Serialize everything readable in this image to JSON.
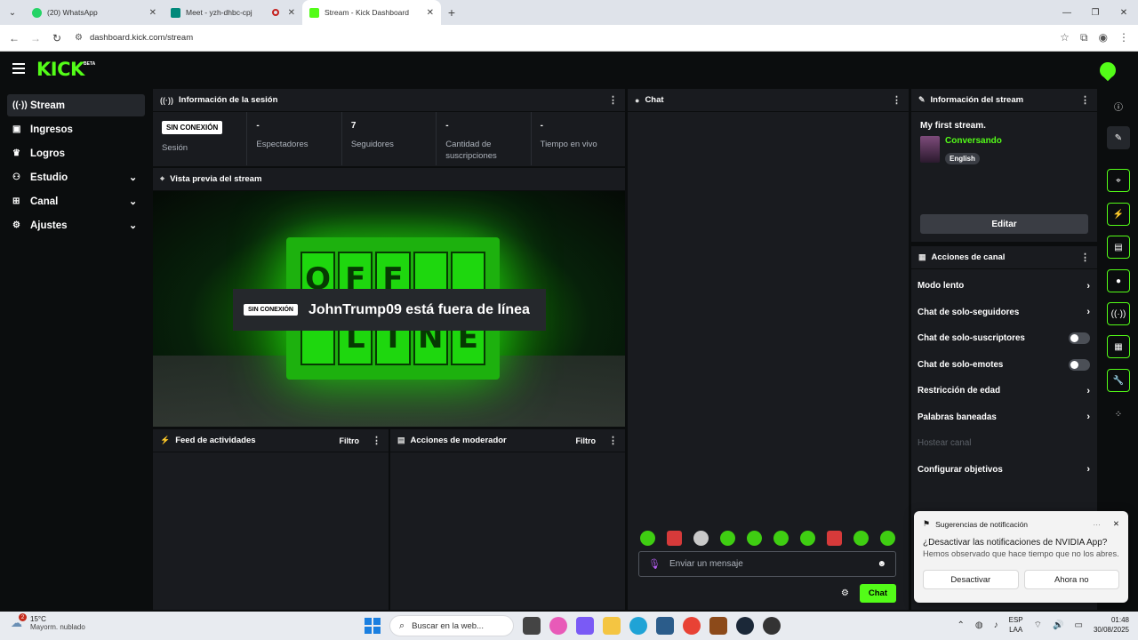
{
  "browser": {
    "tabs": [
      {
        "title": "(20) WhatsApp",
        "favicon_color": "#25d366"
      },
      {
        "title": "Meet - yzh-dhbc-cpj",
        "favicon_color": "#00897b"
      },
      {
        "title": "Stream - Kick Dashboard",
        "favicon_color": "#53fc18"
      }
    ],
    "url": "dashboard.kick.com/stream"
  },
  "header": {
    "logo": "KICK",
    "logo_badge": "BETA"
  },
  "sidebar": {
    "items": [
      {
        "label": "Stream",
        "icon": "broadcast-icon"
      },
      {
        "label": "Ingresos",
        "icon": "wallet-icon"
      },
      {
        "label": "Logros",
        "icon": "trophy-icon"
      },
      {
        "label": "Estudio",
        "icon": "studio-icon"
      },
      {
        "label": "Canal",
        "icon": "channel-icon"
      },
      {
        "label": "Ajustes",
        "icon": "gear-icon"
      }
    ]
  },
  "session": {
    "title": "Información de la sesión",
    "status_badge": "SIN CONEXIÓN",
    "stats": [
      {
        "value": "",
        "label": "Sesión"
      },
      {
        "value": "-",
        "label": "Espectadores"
      },
      {
        "value": "7",
        "label": "Seguidores"
      },
      {
        "value": "-",
        "label": "Cantidad de suscripciones"
      },
      {
        "value": "-",
        "label": "Tiempo en vivo"
      }
    ]
  },
  "preview": {
    "title": "Vista previa del stream",
    "badge": "SIN CONEXIÓN",
    "offline_text": "JohnTrump09 está fuera de línea",
    "sign_letters": [
      "O",
      "F",
      "F",
      "",
      "",
      "",
      "L",
      "I",
      "N",
      "E"
    ]
  },
  "activity": {
    "title": "Feed de actividades",
    "filter": "Filtro"
  },
  "moderator": {
    "title": "Acciones de moderador",
    "filter": "Filtro"
  },
  "chat": {
    "title": "Chat",
    "input_placeholder": "Enviar un mensaje",
    "send_label": "Chat"
  },
  "stream_info": {
    "title": "Información del stream",
    "stream_title": "My first stream.",
    "category": "Conversando",
    "language": "English",
    "edit_label": "Editar"
  },
  "channel_actions": {
    "title": "Acciones de canal",
    "items": [
      {
        "label": "Modo lento",
        "control": "chevron"
      },
      {
        "label": "Chat de solo-seguidores",
        "control": "chevron"
      },
      {
        "label": "Chat de solo-suscriptores",
        "control": "toggle"
      },
      {
        "label": "Chat de solo-emotes",
        "control": "toggle"
      },
      {
        "label": "Restricción de edad",
        "control": "chevron"
      },
      {
        "label": "Palabras baneadas",
        "control": "chevron"
      },
      {
        "label": "Hostear canal",
        "control": "none"
      },
      {
        "label": "Configurar objetivos",
        "control": "chevron"
      }
    ]
  },
  "notification": {
    "source": "Sugerencias de notificación",
    "title": "¿Desactivar las notificaciones de NVIDIA App?",
    "body": "Hemos observado que hace tiempo que no los abres.",
    "btn_disable": "Desactivar",
    "btn_later": "Ahora no"
  },
  "taskbar": {
    "weather_temp": "15°C",
    "weather_desc": "Mayorm. nublado",
    "weather_badge": "2",
    "search_placeholder": "Buscar en la web...",
    "lang_1": "ESP",
    "lang_2": "LAA",
    "time": "01:48",
    "date": "30/08/2025"
  },
  "colors": {
    "accent": "#53fc18",
    "panel": "#191b1f",
    "background": "#0b0d0e"
  }
}
